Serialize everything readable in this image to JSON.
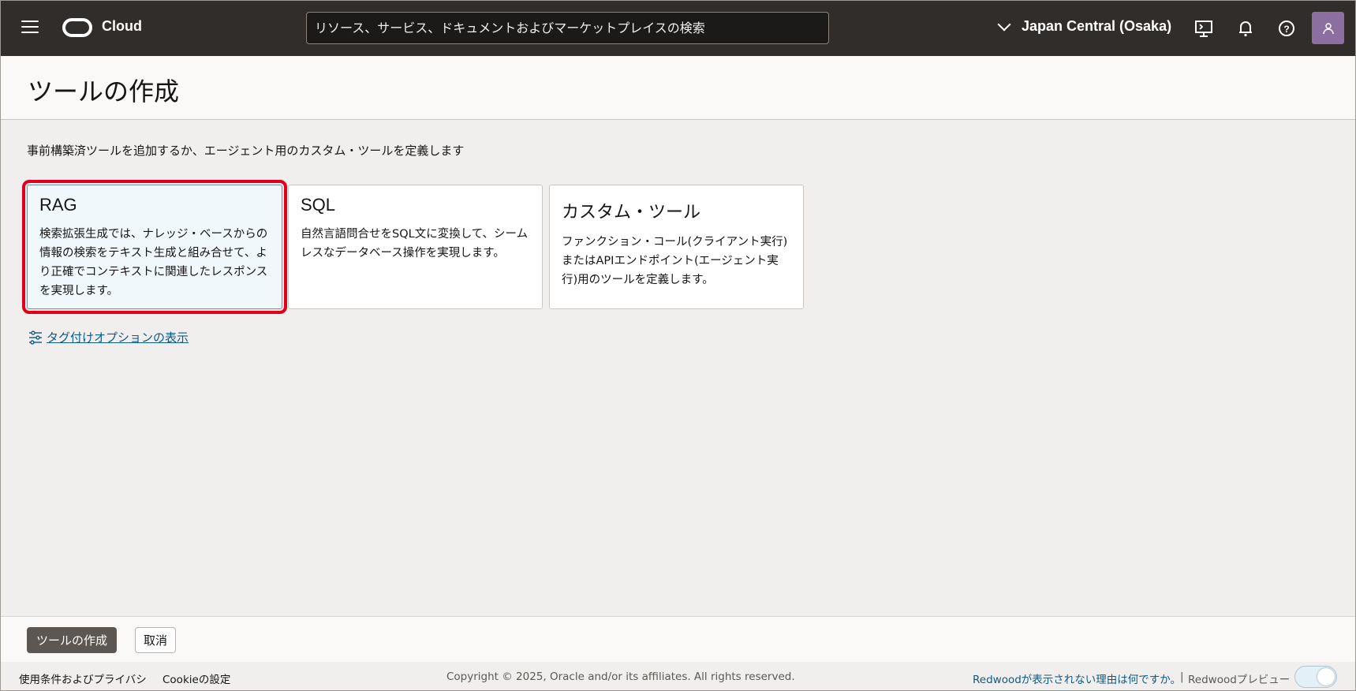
{
  "header": {
    "brand": "Cloud",
    "search_placeholder": "リソース、サービス、ドキュメントおよびマーケットプレイスの検索",
    "region": "Japan Central (Osaka)"
  },
  "page": {
    "title": "ツールの作成",
    "intro": "事前構築済ツールを追加するか、エージェント用のカスタム・ツールを定義します"
  },
  "cards": [
    {
      "title": "RAG",
      "desc": "検索拡張生成では、ナレッジ・ベースからの情報の検索をテキスト生成と組み合せて、より正確でコンテキストに関連したレスポンスを実現します。",
      "selected": true
    },
    {
      "title": "SQL",
      "desc": "自然言語問合せをSQL文に変換して、シームレスなデータベース操作を実現します。",
      "selected": false
    },
    {
      "title": "カスタム・ツール",
      "desc": "ファンクション・コール(クライアント実行)またはAPIエンドポイント(エージェント実行)用のツールを定義します。",
      "selected": false
    }
  ],
  "tag_link": "タグ付けオプションの表示",
  "actions": {
    "create": "ツールの作成",
    "cancel": "取消"
  },
  "footer": {
    "terms": "使用条件およびプライバシ",
    "cookies": "Cookieの設定",
    "copyright": "Copyright © 2025, Oracle and/or its affiliates. All rights reserved.",
    "redwood_link": "Redwoodが表示されない理由は何ですか。",
    "separator": "|",
    "redwood_preview": "Redwoodプレビュー"
  },
  "colors": {
    "header_bg": "#312d2a",
    "selected_outline": "#e0001b",
    "link": "#0d5a86",
    "primary_button": "#5c5753"
  }
}
